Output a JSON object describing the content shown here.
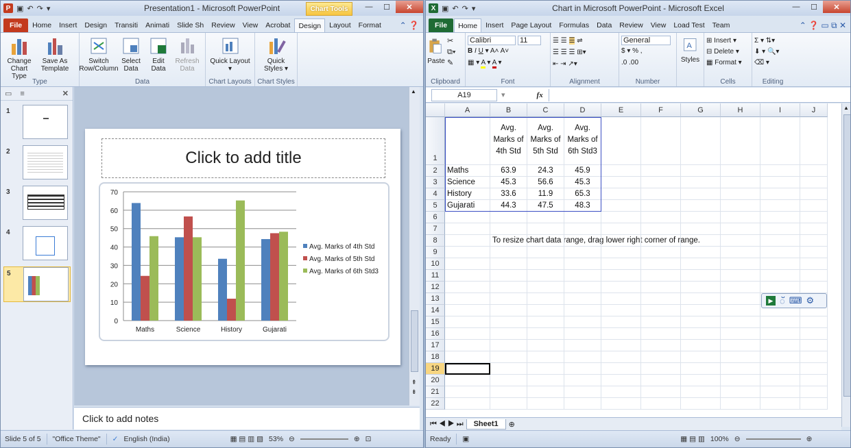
{
  "ppt": {
    "title": "Presentation1 - Microsoft PowerPoint",
    "context_tab": "Chart Tools",
    "tabs": [
      "File",
      "Home",
      "Insert",
      "Design",
      "Transiti",
      "Animati",
      "Slide Sh",
      "Review",
      "View",
      "Acrobat",
      "Design",
      "Layout",
      "Format"
    ],
    "active_tab_index": 10,
    "ribbon": {
      "groups": [
        {
          "label": "Type",
          "buttons": [
            "Change Chart Type",
            "Save As Template"
          ]
        },
        {
          "label": "Data",
          "buttons": [
            "Switch Row/Column",
            "Select Data",
            "Edit Data",
            "Refresh Data"
          ]
        },
        {
          "label": "Chart Layouts",
          "buttons": [
            "Quick Layout ▾"
          ]
        },
        {
          "label": "Chart Styles",
          "buttons": [
            "Quick Styles ▾"
          ]
        }
      ]
    },
    "slide_numbers": [
      "1",
      "2",
      "3",
      "4",
      "5"
    ],
    "slide_title_placeholder": "Click to add title",
    "notes_placeholder": "Click to add notes",
    "status": {
      "slide": "Slide 5 of 5",
      "theme": "\"Office Theme\"",
      "language": "English (India)",
      "zoom": "53%"
    }
  },
  "chart_data": {
    "type": "bar",
    "categories": [
      "Maths",
      "Science",
      "History",
      "Gujarati"
    ],
    "series": [
      {
        "name": "Avg. Marks of 4th Std",
        "values": [
          63.9,
          45.3,
          33.6,
          44.3
        ],
        "color": "#4f81bd"
      },
      {
        "name": "Avg. Marks of 5th Std",
        "values": [
          24.3,
          56.6,
          11.9,
          47.5
        ],
        "color": "#c0504d"
      },
      {
        "name": "Avg. Marks of 6th Std3",
        "values": [
          45.9,
          45.3,
          65.3,
          48.3
        ],
        "color": "#9bbb59"
      }
    ],
    "yticks": [
      "0",
      "10",
      "20",
      "30",
      "40",
      "50",
      "60",
      "70"
    ],
    "ylim": [
      0,
      70
    ],
    "legend": "right",
    "grid": true
  },
  "xl": {
    "title": "Chart in Microsoft PowerPoint - Microsoft Excel",
    "tabs": [
      "File",
      "Home",
      "Insert",
      "Page Layout",
      "Formulas",
      "Data",
      "Review",
      "View",
      "Load Test",
      "Team"
    ],
    "active_tab_index": 1,
    "ribbon": {
      "clipboard": {
        "label": "Clipboard",
        "paste": "Paste"
      },
      "font": {
        "label": "Font",
        "name": "Calibri",
        "size": "11"
      },
      "alignment": {
        "label": "Alignment"
      },
      "number": {
        "label": "Number",
        "format": "General"
      },
      "styles": {
        "label": "Styles"
      },
      "cells": {
        "label": "Cells",
        "insert": "Insert",
        "delete": "Delete",
        "format": "Format"
      },
      "editing": {
        "label": "Editing"
      }
    },
    "name_box": "A19",
    "fx": "fx",
    "columns": [
      "A",
      "B",
      "C",
      "D",
      "E",
      "F",
      "G",
      "H",
      "I",
      "J"
    ],
    "rows": [
      "1",
      "2",
      "3",
      "4",
      "5",
      "6",
      "7",
      "8",
      "9",
      "10",
      "11",
      "12",
      "13",
      "14",
      "15",
      "16",
      "17",
      "18",
      "19",
      "20",
      "21",
      "22"
    ],
    "header_row": [
      "",
      "Avg.",
      "Avg.",
      "Avg."
    ],
    "header_row2": [
      "",
      "Marks of",
      "Marks of",
      "Marks of"
    ],
    "header_row3": [
      "",
      "4th Std",
      "5th Std",
      "6th Std3"
    ],
    "data_rows": [
      [
        "Maths",
        "63.9",
        "24.3",
        "45.9"
      ],
      [
        "Science",
        "45.3",
        "56.6",
        "45.3"
      ],
      [
        "History",
        "33.6",
        "11.9",
        "65.3"
      ],
      [
        "Gujarati",
        "44.3",
        "47.5",
        "48.3"
      ]
    ],
    "resize_note": "To resize chart data range, drag lower right corner of range.",
    "sheet_tab": "Sheet1",
    "status": {
      "ready": "Ready",
      "zoom": "100%"
    }
  }
}
